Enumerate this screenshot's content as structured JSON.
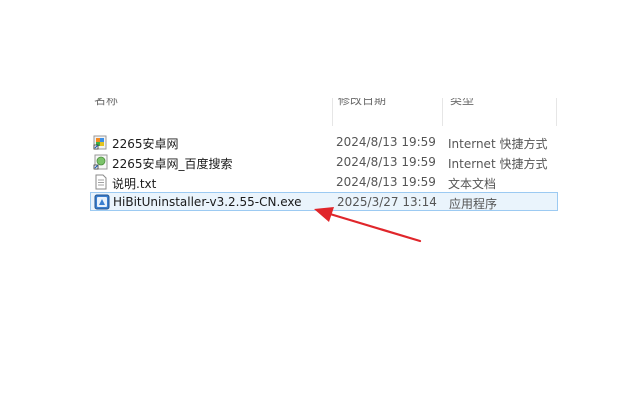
{
  "columns": {
    "name": "名称",
    "date_modified": "修改日期",
    "type": "类型"
  },
  "files": [
    {
      "name": "2265安卓网",
      "date": "2024/8/13 19:59",
      "type": "Internet 快捷方式",
      "icon": "internet-shortcut-icon"
    },
    {
      "name": "2265安卓网_百度搜索",
      "date": "2024/8/13 19:59",
      "type": "Internet 快捷方式",
      "icon": "internet-shortcut-icon"
    },
    {
      "name": "说明.txt",
      "date": "2024/8/13 19:59",
      "type": "文本文档",
      "icon": "text-document-icon"
    },
    {
      "name": "HiBitUninstaller-v3.2.55-CN.exe",
      "date": "2025/3/27 13:14",
      "type": "应用程序",
      "icon": "application-icon"
    }
  ],
  "selected_index": 3,
  "colors": {
    "arrow": "#e0262b",
    "selection_bg": "#eaf4fc",
    "selection_border": "#9ccaf2"
  }
}
